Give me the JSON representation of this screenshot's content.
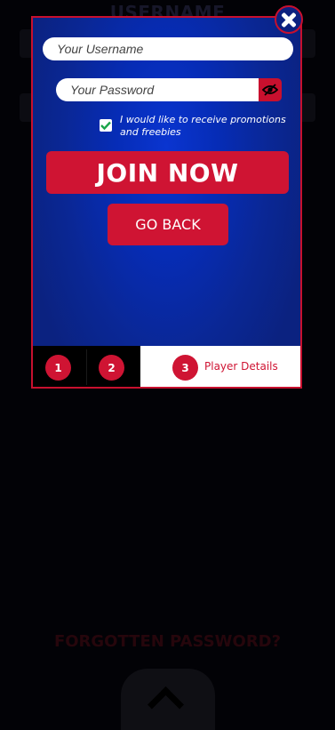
{
  "background": {
    "title": "USERNAME",
    "forgot_link": "FORGOTTEN PASSWORD?",
    "scroll_up_icon": "chevron-up-icon"
  },
  "modal": {
    "close_icon": "close-icon",
    "username": {
      "value": "",
      "placeholder": "Your Username"
    },
    "password": {
      "value": "",
      "placeholder": "Your Password"
    },
    "show_password_icon": "eye-icon",
    "promotions": {
      "checked": true,
      "label": "I would like to receive promotions and freebies"
    },
    "join_label": "JOIN NOW",
    "back_label": "GO BACK",
    "steps": [
      {
        "number": "1",
        "label": ""
      },
      {
        "number": "2",
        "label": ""
      },
      {
        "number": "3",
        "label": "Player Details",
        "active": true
      }
    ]
  },
  "colors": {
    "accent_red": "#cf1433",
    "modal_blue": "#062cb6",
    "page_bg": "#020206"
  }
}
